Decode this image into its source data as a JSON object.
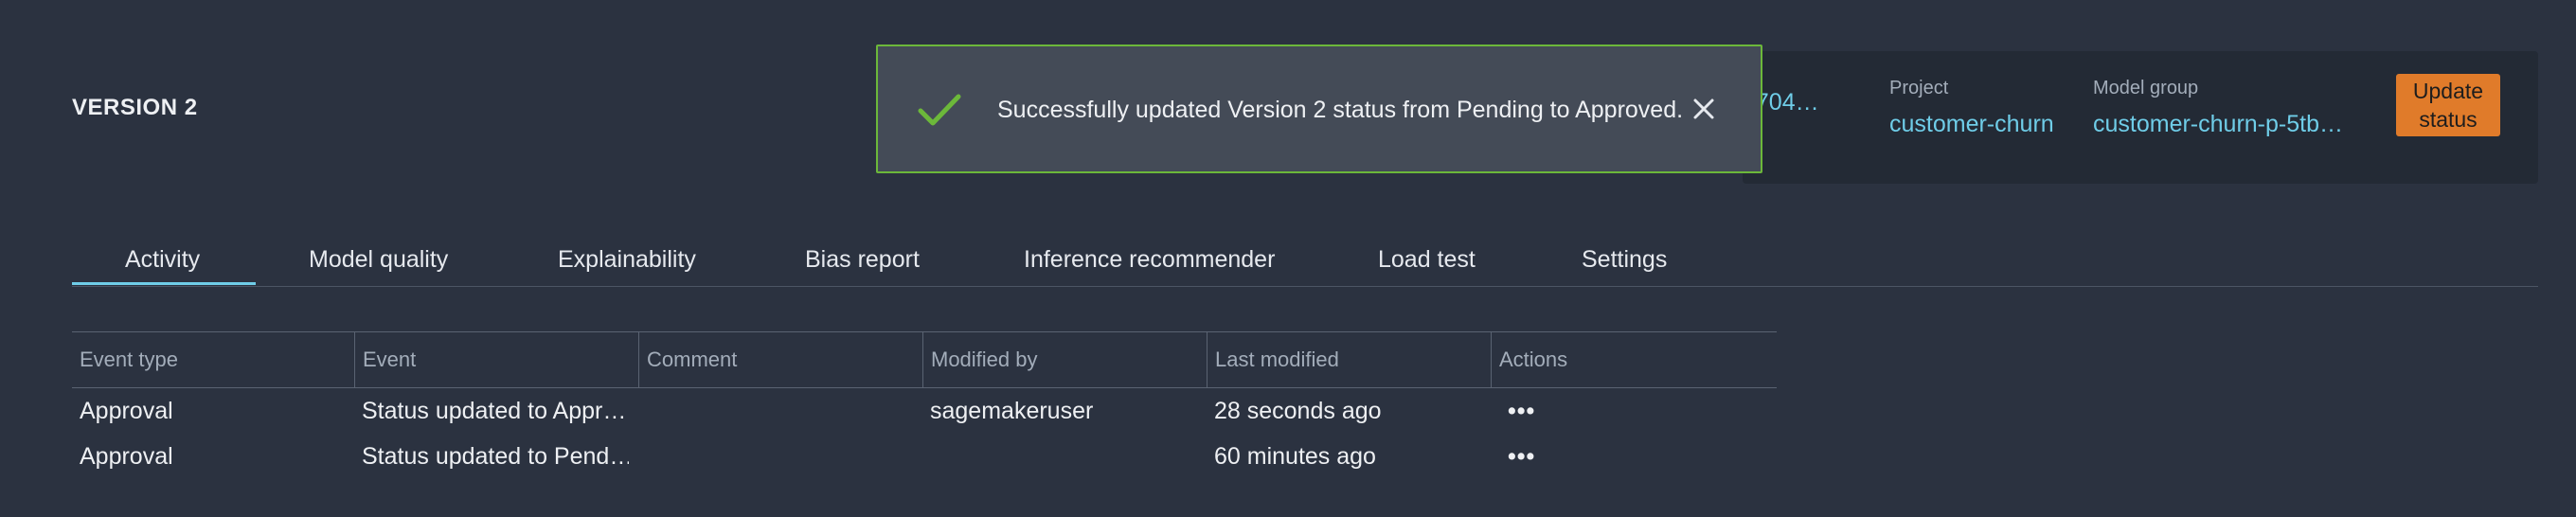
{
  "page": {
    "version_title": "VERSION 2"
  },
  "info_panel": {
    "items": [
      {
        "label": "",
        "value": "1704…"
      },
      {
        "label": "Project",
        "value": "customer-churn"
      },
      {
        "label": "Model group",
        "value": "customer-churn-p-5tb…"
      }
    ],
    "update_button_label": "Update status"
  },
  "toast": {
    "message": "Successfully updated Version 2 status from Pending to Approved.",
    "icon": "check-icon",
    "close_icon": "close-icon",
    "accent_color": "#6cb83a"
  },
  "tabs": [
    {
      "label": "Activity",
      "active": true
    },
    {
      "label": "Model quality"
    },
    {
      "label": "Explainability"
    },
    {
      "label": "Bias report"
    },
    {
      "label": "Inference recommender"
    },
    {
      "label": "Load test"
    },
    {
      "label": "Settings"
    }
  ],
  "table": {
    "columns": [
      "Event type",
      "Event",
      "Comment",
      "Modified by",
      "Last modified",
      "Actions"
    ],
    "rows": [
      {
        "event_type": "Approval",
        "event": "Status updated to Appr…",
        "comment": "",
        "modified_by": "sagemakeruser",
        "last_modified": "28 seconds ago",
        "actions": "•••"
      },
      {
        "event_type": "Approval",
        "event": "Status updated to Pend…",
        "comment": "",
        "modified_by": "",
        "last_modified": "60 minutes ago",
        "actions": "•••"
      }
    ]
  },
  "colors": {
    "background": "#2b3240",
    "link": "#6fcde8",
    "primary_button": "#e07b2a",
    "tab_active": "#6fcde8"
  }
}
